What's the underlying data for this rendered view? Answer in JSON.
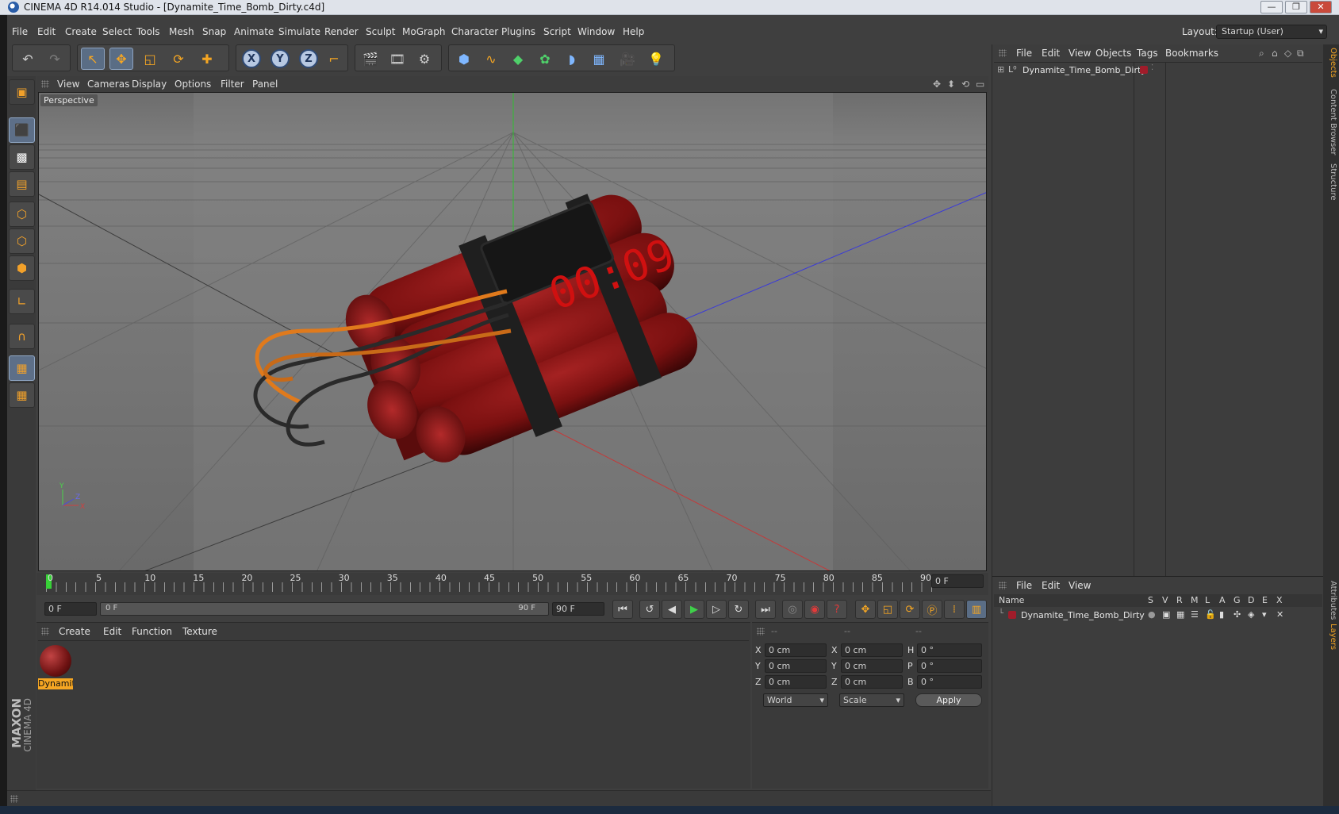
{
  "window": {
    "title": "CINEMA 4D R14.014 Studio - [Dynamite_Time_Bomb_Dirty.c4d]",
    "controls": {
      "minimize": "—",
      "restore": "❐",
      "close": "✕"
    }
  },
  "menubar": {
    "items": [
      "File",
      "Edit",
      "Create",
      "Select",
      "Tools",
      "Mesh",
      "Snap",
      "Animate",
      "Simulate",
      "Render",
      "Sculpt",
      "MoGraph",
      "Character",
      "Plugins",
      "Script",
      "Window",
      "Help"
    ],
    "layout_label": "Layout:",
    "layout_value": "Startup (User)"
  },
  "toolbar": {
    "icons": [
      "undo-icon",
      "redo-icon",
      "live-selection-icon",
      "move-icon",
      "scale-icon",
      "rotate-icon",
      "add-icon",
      "x-axis-icon",
      "y-axis-icon",
      "z-axis-icon",
      "coordinate-system-icon",
      "render-view-icon",
      "render-picture-viewer-icon",
      "render-settings-icon",
      "cube-icon",
      "spline-icon",
      "nurbs-icon",
      "array-icon",
      "deformer-icon",
      "floor-icon",
      "camera-icon",
      "light-icon"
    ],
    "axis_labels": {
      "x": "X",
      "y": "Y",
      "z": "Z"
    }
  },
  "viewport": {
    "menu": [
      "View",
      "Cameras",
      "Display",
      "Options",
      "Filter",
      "Panel"
    ],
    "label": "Perspective",
    "bomb_timer_text": "00:09",
    "gizmo": {
      "y": "Y",
      "x": "X",
      "z": "Z"
    }
  },
  "timeline": {
    "ticks": [
      "0",
      "5",
      "10",
      "15",
      "20",
      "25",
      "30",
      "35",
      "40",
      "45",
      "50",
      "55",
      "60",
      "65",
      "70",
      "75",
      "80",
      "85",
      "90"
    ],
    "current_frame": "0 F"
  },
  "transport": {
    "start_frame": "0 F",
    "range_start": "0 F",
    "range_end": "90 F",
    "end_frame": "90 F"
  },
  "materials": {
    "menu": [
      "Create",
      "Edit",
      "Function",
      "Texture"
    ],
    "items": [
      {
        "name": "Dynamit",
        "color": "#8f1c1c"
      }
    ]
  },
  "coordinates": {
    "headers": [
      "--",
      "--",
      "--"
    ],
    "rows": [
      {
        "l1": "X",
        "v1": "0 cm",
        "l2": "X",
        "v2": "0 cm",
        "l3": "H",
        "v3": "0 °"
      },
      {
        "l1": "Y",
        "v1": "0 cm",
        "l2": "Y",
        "v2": "0 cm",
        "l3": "P",
        "v3": "0 °"
      },
      {
        "l1": "Z",
        "v1": "0 cm",
        "l2": "Z",
        "v2": "0 cm",
        "l3": "B",
        "v3": "0 °"
      }
    ],
    "mode": "World",
    "transform": "Scale",
    "apply_label": "Apply"
  },
  "object_manager": {
    "menu": [
      "File",
      "Edit",
      "View",
      "Objects",
      "Tags",
      "Bookmarks"
    ],
    "objects": [
      {
        "name": "Dynamite_Time_Bomb_Dirty",
        "color": "#a01c2a"
      }
    ]
  },
  "layer_manager": {
    "menu": [
      "File",
      "Edit",
      "View"
    ],
    "columns": [
      "Name",
      "S",
      "V",
      "R",
      "M",
      "L",
      "A",
      "G",
      "D",
      "E",
      "X"
    ],
    "layers": [
      {
        "name": "Dynamite_Time_Bomb_Dirty",
        "color": "#a01c2a"
      }
    ]
  },
  "side_tabs": [
    "Objects",
    "Content Browser",
    "Structure",
    "Attributes",
    "Layers"
  ],
  "branding": {
    "maxon": "MAXON",
    "product": "CINEMA 4D"
  },
  "colors": {
    "accent": "#f5a623",
    "selected": "#5a6d85",
    "bg": "#3f3f3f"
  }
}
